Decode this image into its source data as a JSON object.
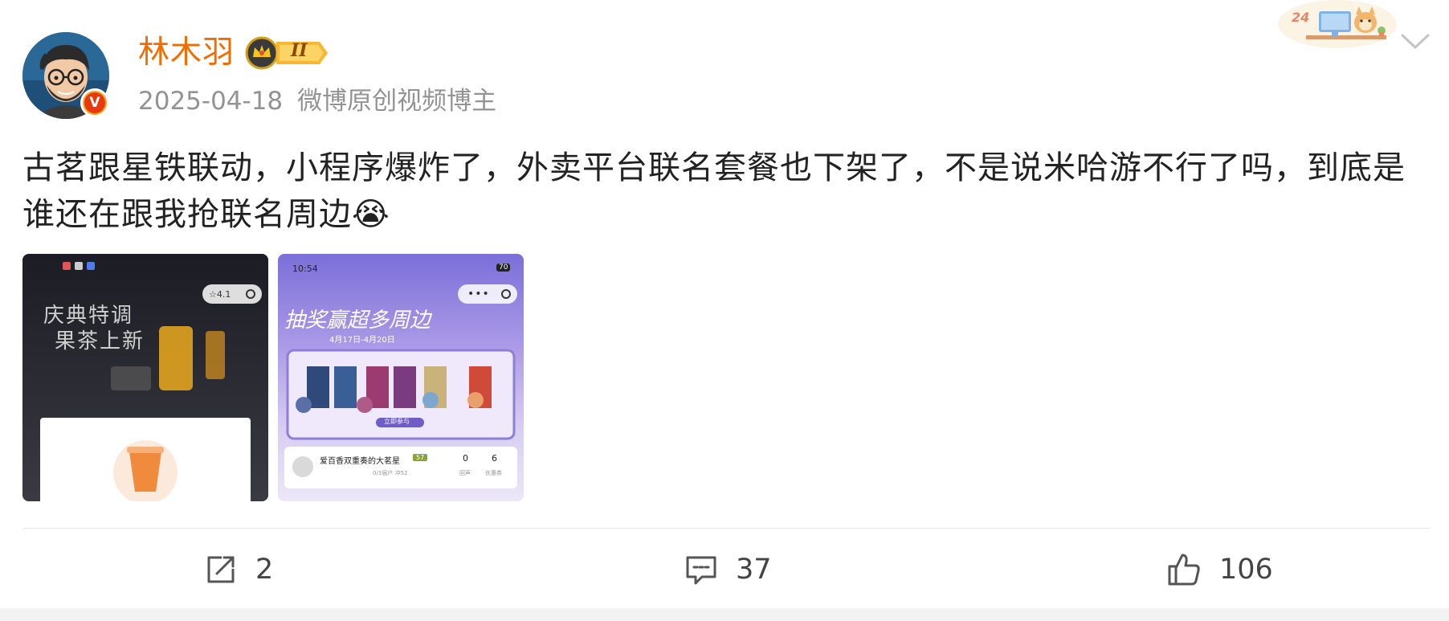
{
  "post": {
    "author": {
      "name": "林木羽",
      "verified_badge": "V",
      "rank_badge": "II"
    },
    "date": "2025-04-18",
    "author_title": "微博原创视频博主",
    "text": "古茗跟星铁联动，小程序爆炸了，外卖平台联名套餐也下架了，不是说米哈游不行了吗，到底是谁还在跟我抢联名周边😭",
    "decor_badge": "24"
  },
  "images": [
    {
      "name": "thumbnail-1",
      "capsule_label": "☆4.1",
      "promo_line1": "庆典特调",
      "promo_line2": "果茶上新"
    },
    {
      "name": "thumbnail-2",
      "status_time": "10:54",
      "status_battery": "70",
      "headline": "抽奖赢超多周边",
      "date_range": "4月17日-4月20日",
      "cta": "立即参与",
      "panel_name": "爱百香双重奏的大茗星",
      "panel_tag": "57",
      "panel_sub": "0/3届户 冲52",
      "stat1_value": "0",
      "stat1_label": "回声",
      "stat2_value": "6",
      "stat2_label": "优惠券"
    }
  ],
  "actions": {
    "repost_count": "2",
    "comment_count": "37",
    "like_count": "106"
  },
  "colors": {
    "username": "#f26c00",
    "meta": "#939393",
    "text": "#222222"
  }
}
